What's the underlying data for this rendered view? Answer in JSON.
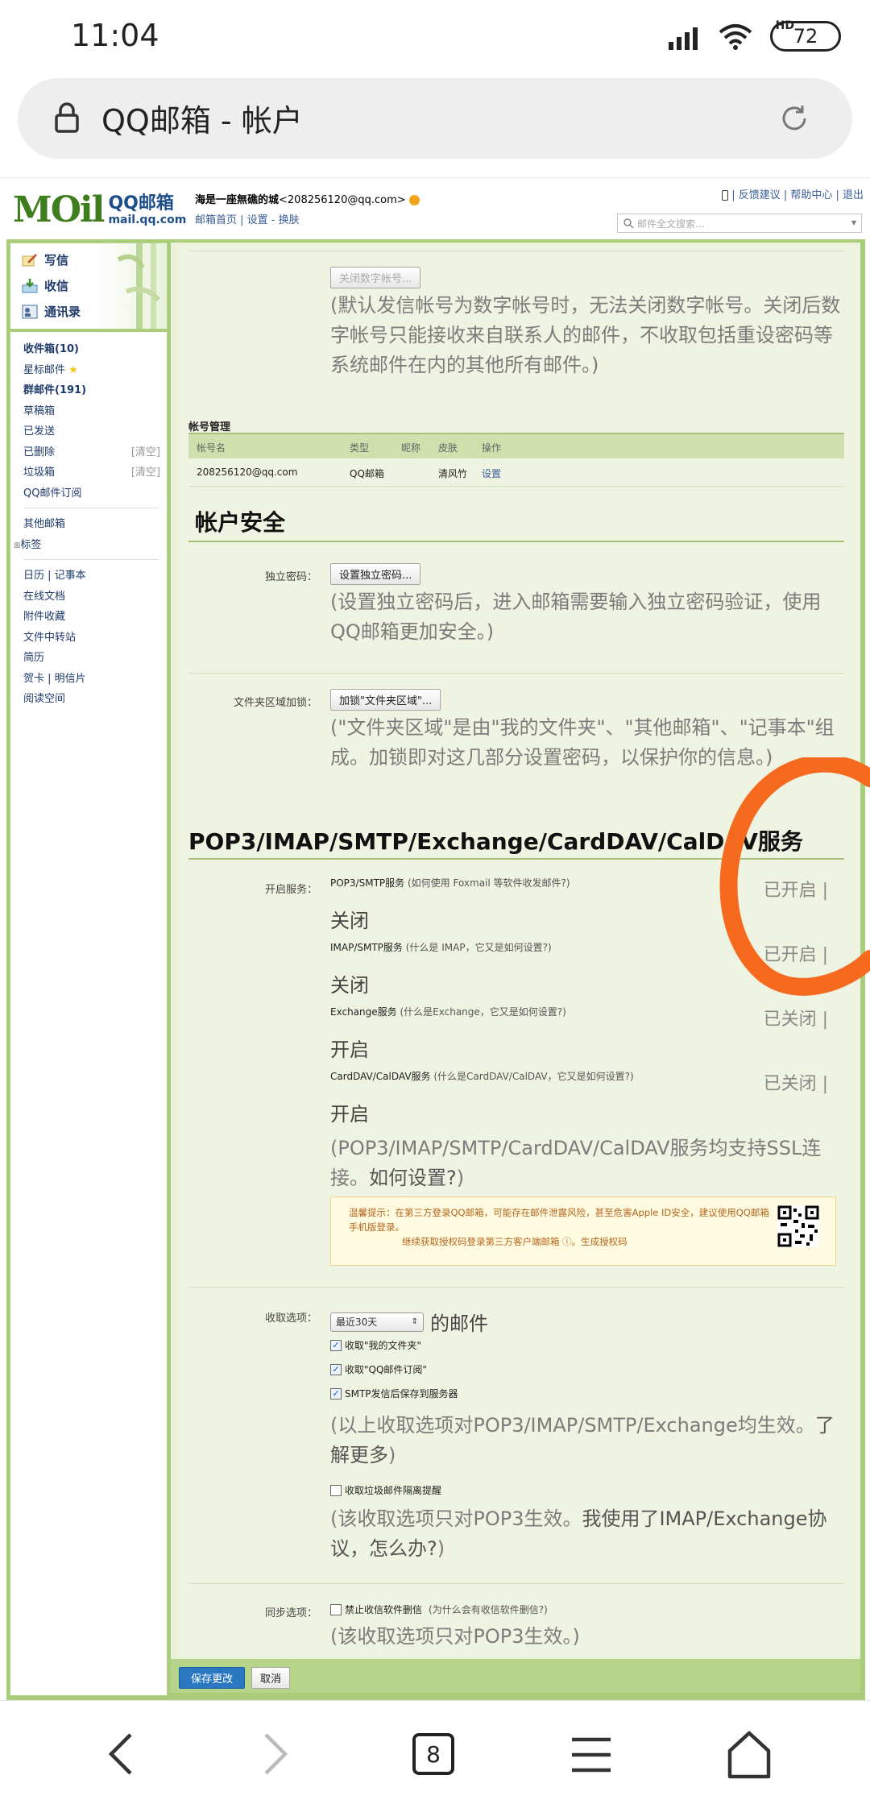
{
  "statusbar": {
    "time": "11:04",
    "network": "HD",
    "battery": "72"
  },
  "browser": {
    "title": "QQ邮箱 - 帐户",
    "tab_count": "8"
  },
  "header": {
    "logo_text": "MOil",
    "logo_brand": "QQ邮箱",
    "logo_domain": "mail.qq.com",
    "user_name": "海是一座無礁的城",
    "user_email": "<208256120@qq.com>",
    "user_links": "邮箱首页 | 设置 - 换肤",
    "top_links": "| 反馈建议 | 帮助中心 | 退出",
    "search_placeholder": "邮件全文搜索..."
  },
  "sidebar": {
    "actions": [
      "写信",
      "收信",
      "通讯录"
    ],
    "folders": [
      {
        "label": "收件箱(10)",
        "bold": true
      },
      {
        "label": "星标邮件",
        "star": true
      },
      {
        "label": "群邮件(191)",
        "bold": true
      },
      {
        "label": "草稿箱"
      },
      {
        "label": "已发送"
      },
      {
        "label": "已删除",
        "clear": "[清空]"
      },
      {
        "label": "垃圾箱",
        "clear": "[清空]"
      },
      {
        "label": "QQ邮件订阅"
      }
    ],
    "other_mailbox": "其他邮箱",
    "tags": "标签",
    "tools": [
      "日历 | 记事本",
      "在线文档",
      "附件收藏",
      "文件中转站",
      "简历",
      "贺卡 | 明信片",
      "阅读空间"
    ]
  },
  "main": {
    "close_digital_btn": "关闭数字帐号...",
    "digital_note": "(默认发信帐号为数字帐号时，无法关闭数字帐号。关闭后数字帐号只能接收来自联系人的邮件，不收取包括重设密码等系统邮件在内的其他所有邮件。)",
    "account_mgmt_title": "帐号管理",
    "table_headers": [
      "帐号名",
      "类型",
      "昵称",
      "皮肤",
      "操作"
    ],
    "table_row": [
      "208256120@qq.com",
      "QQ邮箱",
      "",
      "清风竹",
      "设置"
    ],
    "security_title": "帐户安全",
    "indep_pw_label": "独立密码：",
    "indep_pw_btn": "设置独立密码...",
    "indep_pw_note": "(设置独立密码后，进入邮箱需要输入独立密码验证，使用QQ邮箱更加安全。)",
    "folder_lock_label": "文件夹区域加锁：",
    "folder_lock_btn": "加锁\"文件夹区域\"...",
    "folder_lock_note": "(\"文件夹区域\"是由\"我的文件夹\"、\"其他邮箱\"、\"记事本\"组成。加锁即对这几部分设置密码，以保护你的信息。)",
    "protocols_title": "POP3/IMAP/SMTP/Exchange/CardDAV/CalDAV服务",
    "services_label": "开启服务：",
    "services": [
      {
        "name": "POP3/SMTP服务",
        "hint": "(如何使用 Foxmail 等软件收发邮件?)",
        "status": "已开启 |",
        "action": "关闭"
      },
      {
        "name": "IMAP/SMTP服务",
        "hint": "(什么是 IMAP，它又是如何设置?)",
        "status": "已开启 |",
        "action": "关闭"
      },
      {
        "name": "Exchange服务",
        "hint": "(什么是Exchange，它又是如何设置?)",
        "status": "已关闭 |",
        "action": "开启"
      },
      {
        "name": "CardDAV/CalDAV服务",
        "hint": "(什么是CardDAV/CalDAV，它又是如何设置?)",
        "status": "已关闭 |",
        "action": "开启"
      }
    ],
    "ssl_note_a": "(POP3/IMAP/SMTP/CardDAV/CalDAV服务均支持SSL连接。",
    "ssl_note_link": "如何设置?",
    "ssl_note_b": ")",
    "notice_text": "温馨提示：在第三方登录QQ邮箱，可能存在邮件泄露风险，甚至危害Apple ID安全，建议使用QQ邮箱手机版登录。",
    "notice_sub": "继续获取授权码登录第三方客户端邮箱 ⓘ。生成授权码",
    "receive_label": "收取选项：",
    "receive_select": "最近30天",
    "receive_suffix": "的邮件",
    "receive_checks": [
      "收取\"我的文件夹\"",
      "收取\"QQ邮件订阅\"",
      "SMTP发信后保存到服务器"
    ],
    "receive_note_a": "(以上收取选项对POP3/IMAP/SMTP/Exchange均生效。",
    "receive_note_link": "了解更多",
    "receive_note_b": ")",
    "spam_check": "收取垃圾邮件隔离提醒",
    "spam_note_a": "(该收取选项只对POP3生效。",
    "spam_note_link": "我使用了IMAP/Exchange协议，怎么办?",
    "spam_note_b": ")",
    "sync_label": "同步选项：",
    "sync_check": "禁止收信软件删信",
    "sync_hint": "(为什么会有收信软件删信?)",
    "sync_note": "(该收取选项只对POP3生效。)",
    "save_btn": "保存更改",
    "cancel_btn": "取消"
  },
  "colors": {
    "accent_green": "#aacd7a",
    "annotation": "#f56a1f",
    "save_blue": "#2b78c2"
  }
}
